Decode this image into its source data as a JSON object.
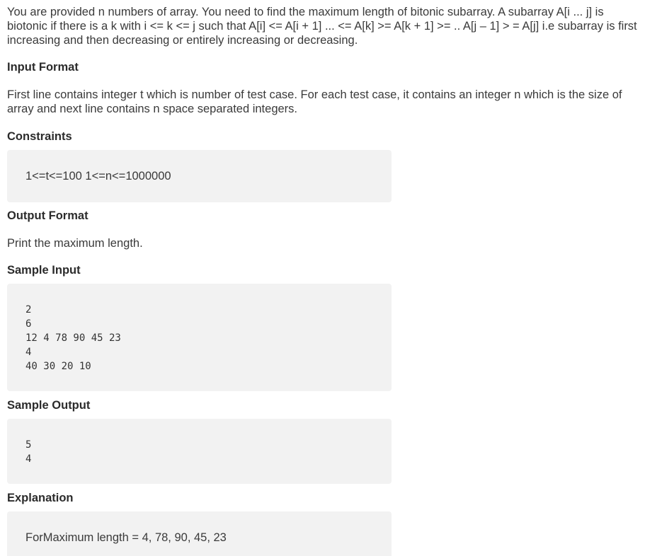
{
  "description": "You are provided n numbers of array. You need to find the maximum length of bitonic subarray. A subarray A[i ... j] is biotonic if there is a k with i <= k <= j such that A[i] <= A[i + 1] ... <= A[k] >= A[k + 1] >= .. A[j – 1] > = A[j] i.e subarray is first increasing and then decreasing or entirely increasing or decreasing.",
  "input_format": {
    "heading": "Input Format",
    "text": "First line contains integer t which is number of test case. For each test case, it contains an integer n which is the size of array and next line contains n space separated integers."
  },
  "constraints": {
    "heading": "Constraints",
    "text": "1<=t<=100 1<=n<=1000000"
  },
  "output_format": {
    "heading": "Output Format",
    "text": "Print the maximum length."
  },
  "sample_input": {
    "heading": "Sample Input",
    "lines": [
      "2",
      "6",
      "12 4 78 90 45 23",
      "4",
      "40 30 20 10"
    ]
  },
  "sample_output": {
    "heading": "Sample Output",
    "lines": [
      "5",
      "4"
    ]
  },
  "explanation": {
    "heading": "Explanation",
    "text": "ForMaximum length = 4, 78, 90, 45, 23"
  }
}
